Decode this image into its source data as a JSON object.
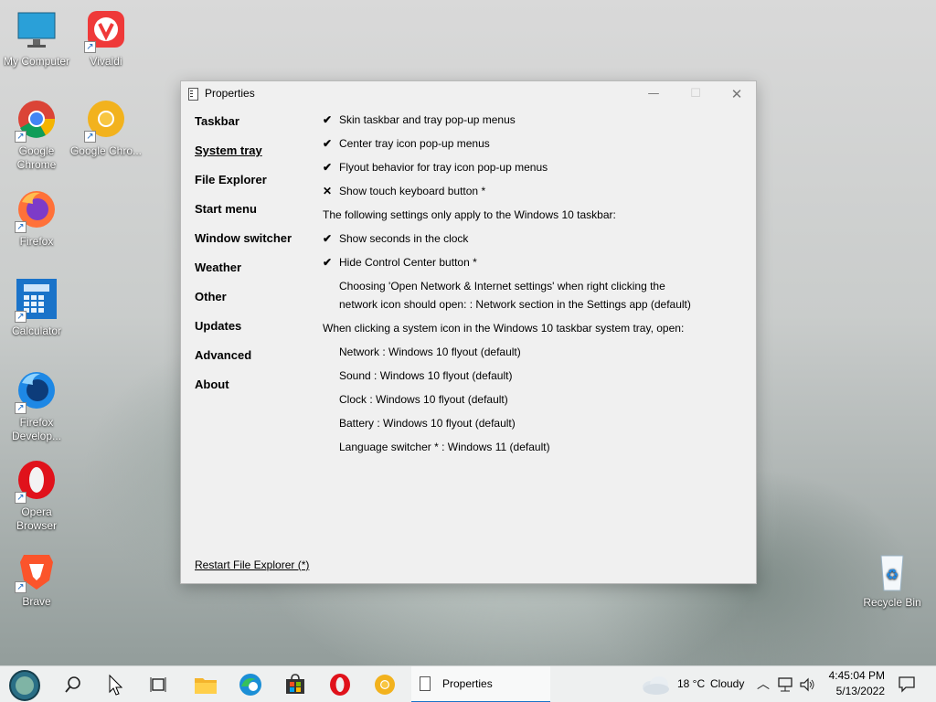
{
  "desktop": {
    "icons": [
      {
        "label": "My Computer"
      },
      {
        "label": "Vivaldi"
      },
      {
        "label": "Google Chrome"
      },
      {
        "label": "Google Chro..."
      },
      {
        "label": "Firefox"
      },
      {
        "label": "Calculator"
      },
      {
        "label": "Firefox Develop..."
      },
      {
        "label": "Opera Browser"
      },
      {
        "label": "Brave"
      },
      {
        "label": "Recycle Bin"
      }
    ]
  },
  "window": {
    "title": "Properties",
    "nav": [
      {
        "label": "Taskbar"
      },
      {
        "label": "System tray"
      },
      {
        "label": "File Explorer"
      },
      {
        "label": "Start menu"
      },
      {
        "label": "Window switcher"
      },
      {
        "label": "Weather"
      },
      {
        "label": "Other"
      },
      {
        "label": "Updates"
      },
      {
        "label": "Advanced"
      },
      {
        "label": "About"
      }
    ],
    "settings": {
      "skin_taskbar": {
        "mark": "✔",
        "label": "Skin taskbar and tray pop-up menus"
      },
      "center_tray": {
        "mark": "✔",
        "label": "Center tray icon pop-up menus"
      },
      "flyout_behavior": {
        "mark": "✔",
        "label": "Flyout behavior for tray icon pop-up menus"
      },
      "touch_keyboard": {
        "mark": "✕",
        "label": "Show touch keyboard button *"
      },
      "win10_note": "The following settings only apply to the Windows 10 taskbar:",
      "show_seconds": {
        "mark": "✔",
        "label": "Show seconds in the clock"
      },
      "hide_control_center": {
        "mark": "✔",
        "label": "Hide Control Center button *"
      },
      "network_line1": "Choosing 'Open Network & Internet settings' when right clicking the",
      "network_line2": "network icon should open: : Network section in the Settings app (default)",
      "system_icon_note": "When clicking a system icon in the Windows 10 taskbar system tray, open:",
      "network": "Network : Windows 10 flyout (default)",
      "sound": "Sound : Windows 10 flyout (default)",
      "clock": "Clock : Windows 10 flyout (default)",
      "battery": "Battery : Windows 10 flyout (default)",
      "language": "Language switcher * : Windows 11 (default)"
    },
    "restart_link": "Restart File Explorer (*)"
  },
  "taskbar": {
    "active_app": "Properties",
    "weather_temp": "18 °C",
    "weather_cond": "Cloudy",
    "time": "4:45:04 PM",
    "date": "5/13/2022"
  }
}
